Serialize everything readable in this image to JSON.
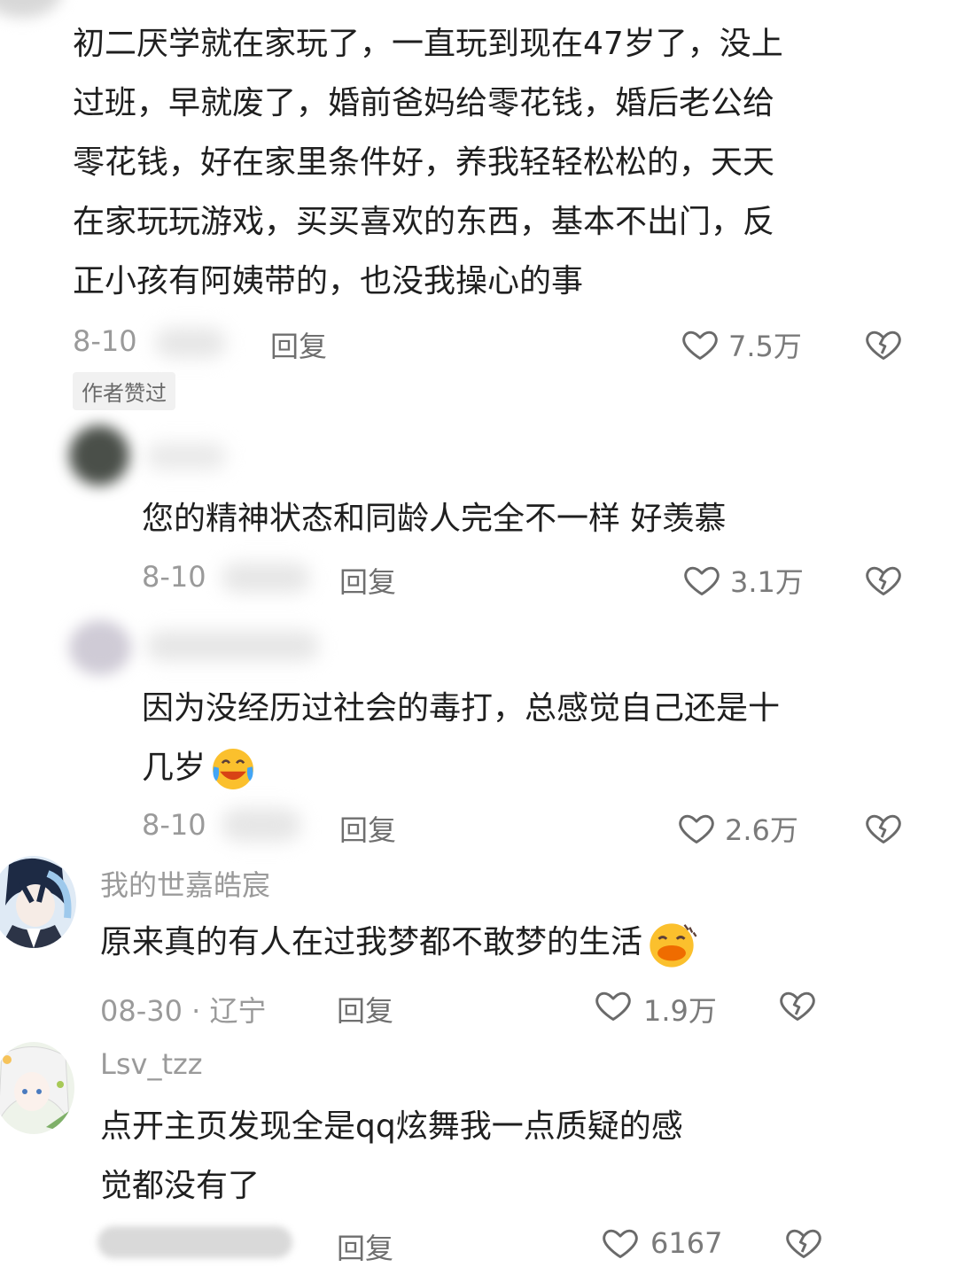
{
  "comments": [
    {
      "text": "初二厌学就在家玩了，一直玩到现在47岁了，没上过班，早就废了，婚前爸妈给零花钱，婚后老公给零花钱，好在家里条件好，养我轻轻松松的，天天在家玩玩游戏，买买喜欢的东西，基本不出门，反正小孩有阿姨带的，也没我操心的事",
      "lines": [
        "初二厌学就在家玩了，一直玩到现在47岁了，没上",
        "过班，早就废了，婚前爸妈给零花钱，婚后老公给",
        "零花钱，好在家里条件好，养我轻轻松松的，天天",
        "在家玩玩游戏，买买喜欢的东西，基本不出门，反",
        "正小孩有阿姨带的，也没我操心的事"
      ],
      "date": "8-10",
      "reply_label": "回复",
      "likes": "7.5万",
      "badge": "作者赞过"
    },
    {
      "text": "您的精神状态和同龄人完全不一样 好羡慕",
      "date": "8-10",
      "reply_label": "回复",
      "likes": "3.1万"
    },
    {
      "line1": "因为没经历过社会的毒打，总感觉自己还是十",
      "line2": "几岁",
      "emoji": "laughing-crying-emoji",
      "date": "8-10",
      "reply_label": "回复",
      "likes": "2.6万"
    },
    {
      "username": "我的世嘉皓宸",
      "text": "原来真的有人在过我梦都不敢梦的生活",
      "emoji": "duck-smile-emoji",
      "date": "08-30 · 辽宁",
      "reply_label": "回复",
      "likes": "1.9万"
    },
    {
      "username": "Lsv_tzz",
      "line1": "点开主页发现全是qq炫舞我一点质疑的感",
      "line2": "觉都没有了",
      "reply_label": "回复",
      "likes": "6167"
    }
  ],
  "icons": {
    "like": "heart-outline-icon",
    "dislike": "broken-heart-icon"
  },
  "colors": {
    "text": "#1f1f1f",
    "meta": "#9a9a9a",
    "accent_emoji": "#f5b400"
  }
}
